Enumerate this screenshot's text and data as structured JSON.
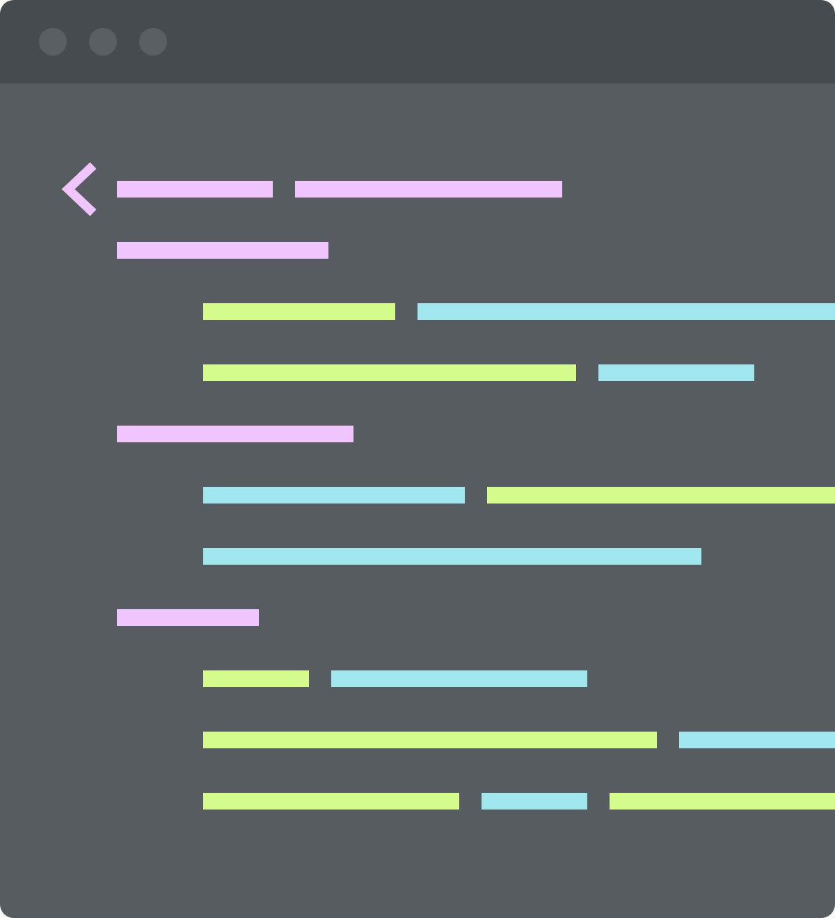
{
  "editor": {
    "lines": [
      {
        "kind": "tag",
        "tokens": [
          {
            "color": "#f0c4fc"
          },
          {
            "color": "#f0c4fc"
          }
        ]
      },
      {
        "kind": "line",
        "tokens": [
          {
            "color": "#f0c4fc"
          }
        ],
        "children": [
          {
            "kind": "line",
            "tokens": [
              {
                "color": "#d4fc8c"
              },
              {
                "color": "#a0e6ee"
              }
            ]
          },
          {
            "kind": "line",
            "tokens": [
              {
                "color": "#d4fc8c"
              },
              {
                "color": "#a0e6ee"
              }
            ]
          }
        ]
      },
      {
        "kind": "line",
        "tokens": [
          {
            "color": "#f0c4fc"
          }
        ],
        "children": [
          {
            "kind": "line",
            "tokens": [
              {
                "color": "#a0e6ee"
              },
              {
                "color": "#d4fc8c"
              }
            ]
          },
          {
            "kind": "line",
            "tokens": [
              {
                "color": "#a0e6ee"
              }
            ]
          }
        ]
      },
      {
        "kind": "line",
        "tokens": [
          {
            "color": "#f0c4fc"
          }
        ],
        "children": [
          {
            "kind": "line",
            "tokens": [
              {
                "color": "#d4fc8c"
              },
              {
                "color": "#a0e6ee"
              }
            ]
          },
          {
            "kind": "line",
            "tokens": [
              {
                "color": "#d4fc8c"
              },
              {
                "color": "#a0e6ee"
              }
            ]
          },
          {
            "kind": "line",
            "tokens": [
              {
                "color": "#d4fc8c"
              },
              {
                "color": "#a0e6ee"
              },
              {
                "color": "#d4fc8c"
              }
            ]
          }
        ]
      }
    ]
  }
}
